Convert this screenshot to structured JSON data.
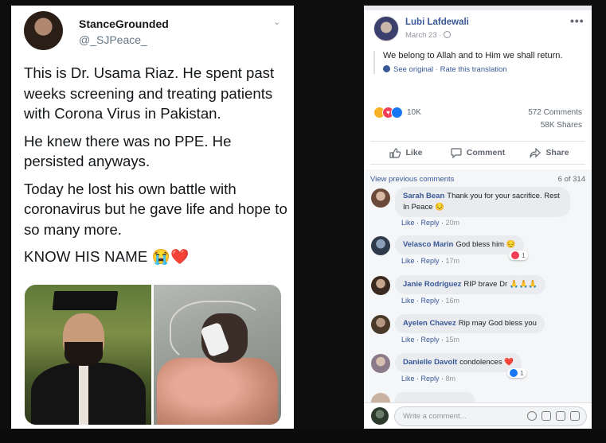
{
  "tweet": {
    "display_name": "StanceGrounded",
    "handle": "@_SJPeace_",
    "paragraphs": [
      "This is Dr. Usama Riaz. He spent past weeks screening and treating patients with Corona Virus in Pakistan.",
      "He knew there was no PPE. He persisted anyways.",
      "Today he lost his own battle with coronavirus but he gave life and hope to so many more."
    ],
    "closing": "KNOW HIS NAME 😭❤️"
  },
  "facebook": {
    "author": "Lubi Lafdewali",
    "date": "March 23 ·",
    "post_text": "We belong to Allah and to Him we shall return.",
    "see_original": "See original",
    "translate_sep": " · ",
    "rate_translation": "Rate this translation",
    "reaction_count": "10K",
    "comments_count": "572 Comments",
    "shares_count": "58K Shares",
    "actions": {
      "like": "Like",
      "comment": "Comment",
      "share": "Share"
    },
    "view_previous": "View previous comments",
    "page_count": "6 of 314",
    "comments": [
      {
        "name": "Sarah Bean",
        "text": "Thank you for your sacrifice. Rest In Peace 😔",
        "like": "Like",
        "reply": "Reply",
        "time": "20m"
      },
      {
        "name": "Velasco Marin",
        "text": "God bless him 😔",
        "like": "Like",
        "reply": "Reply",
        "time": "17m",
        "reaction_count": "1"
      },
      {
        "name": "Janie Rodriguez",
        "text": "RIP brave Dr 🙏🙏🙏",
        "like": "Like",
        "reply": "Reply",
        "time": "16m"
      },
      {
        "name": "Ayelen Chavez",
        "text": "Rip may God bless you",
        "like": "Like",
        "reply": "Reply",
        "time": "15m"
      },
      {
        "name": "Danielle Davolt",
        "text": "condolences ❤️",
        "like": "Like",
        "reply": "Reply",
        "time": "8m",
        "reaction_count": "1"
      }
    ],
    "write_placeholder": "Write a comment...",
    "colors": {
      "link": "#385898",
      "like_blue": "#1877f2",
      "love_red": "#f33e58",
      "sad_yellow": "#f7b125"
    }
  }
}
